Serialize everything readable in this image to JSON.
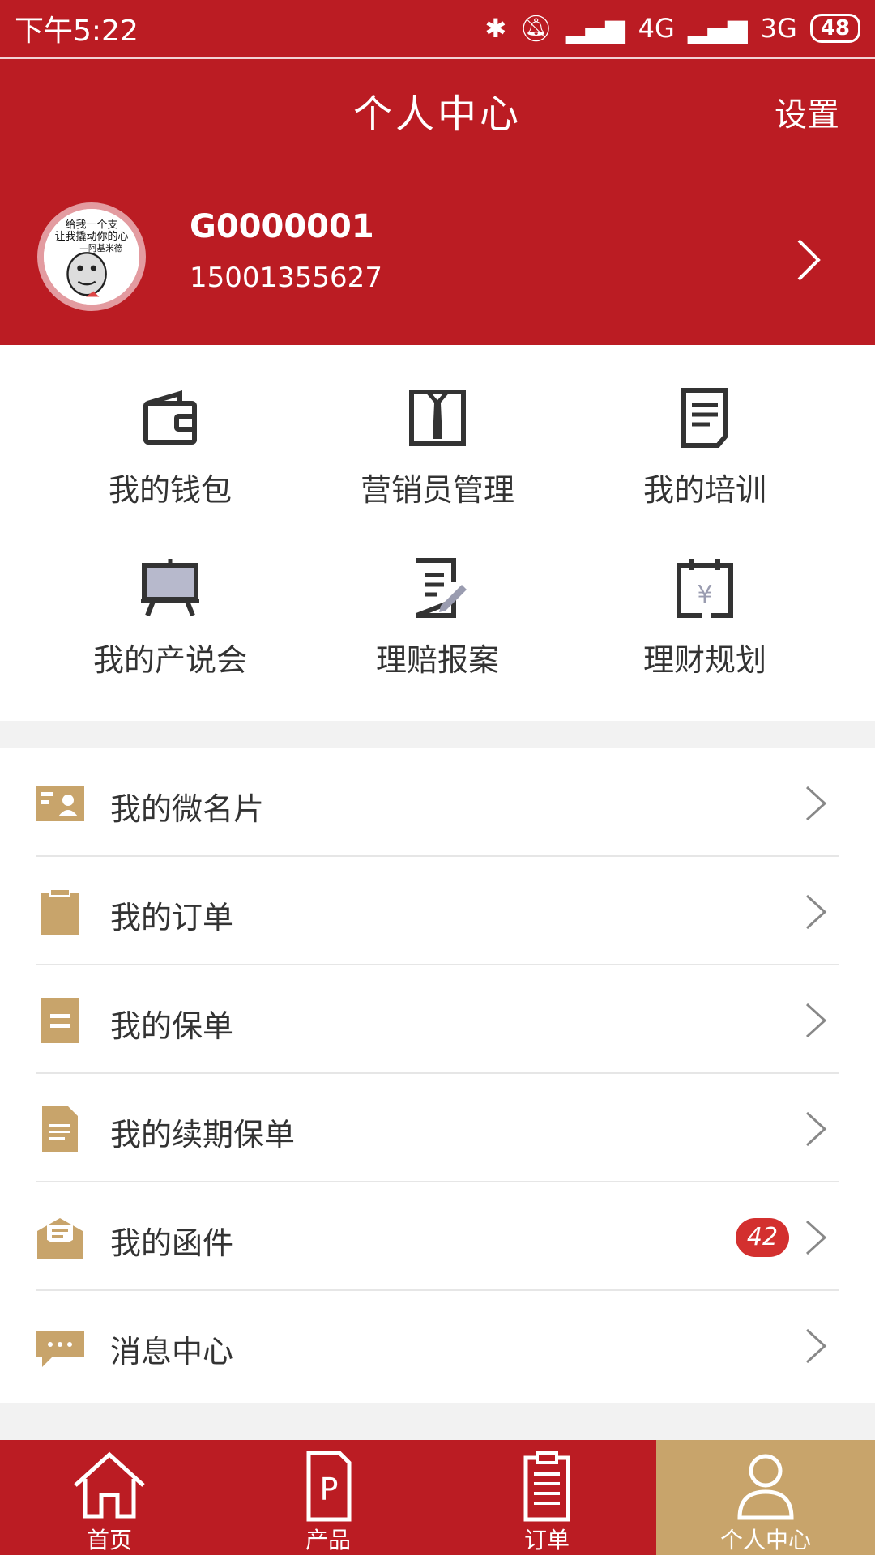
{
  "status_bar": {
    "time": "下午5:22",
    "network1": "4G",
    "network2": "3G",
    "battery": "48"
  },
  "header": {
    "title": "个人中心",
    "settings_label": "设置"
  },
  "profile": {
    "name": "G0000001",
    "phone": "15001355627"
  },
  "grid": [
    {
      "label": "我的钱包",
      "icon": "wallet-icon"
    },
    {
      "label": "营销员管理",
      "icon": "suit-icon"
    },
    {
      "label": "我的培训",
      "icon": "document-icon"
    },
    {
      "label": "我的产说会",
      "icon": "presentation-board-icon"
    },
    {
      "label": "理赔报案",
      "icon": "edit-document-icon"
    },
    {
      "label": "理财规划",
      "icon": "calendar-yen-icon"
    }
  ],
  "list": [
    {
      "label": "我的微名片",
      "icon": "business-card-icon"
    },
    {
      "label": "我的订单",
      "icon": "clipboard-icon"
    },
    {
      "label": "我的保单",
      "icon": "policy-icon"
    },
    {
      "label": "我的续期保单",
      "icon": "file-icon"
    },
    {
      "label": "我的函件",
      "icon": "mail-icon",
      "badge": "42"
    },
    {
      "label": "消息中心",
      "icon": "chat-bubble-icon"
    }
  ],
  "tabs": [
    {
      "label": "首页",
      "icon": "home-icon",
      "active": false
    },
    {
      "label": "产品",
      "icon": "product-icon",
      "active": false
    },
    {
      "label": "订单",
      "icon": "order-icon",
      "active": false
    },
    {
      "label": "个人中心",
      "icon": "user-icon",
      "active": true
    }
  ],
  "colors": {
    "primary": "#bb1c23",
    "accent": "#c8a46b",
    "badge": "#d3302f"
  }
}
